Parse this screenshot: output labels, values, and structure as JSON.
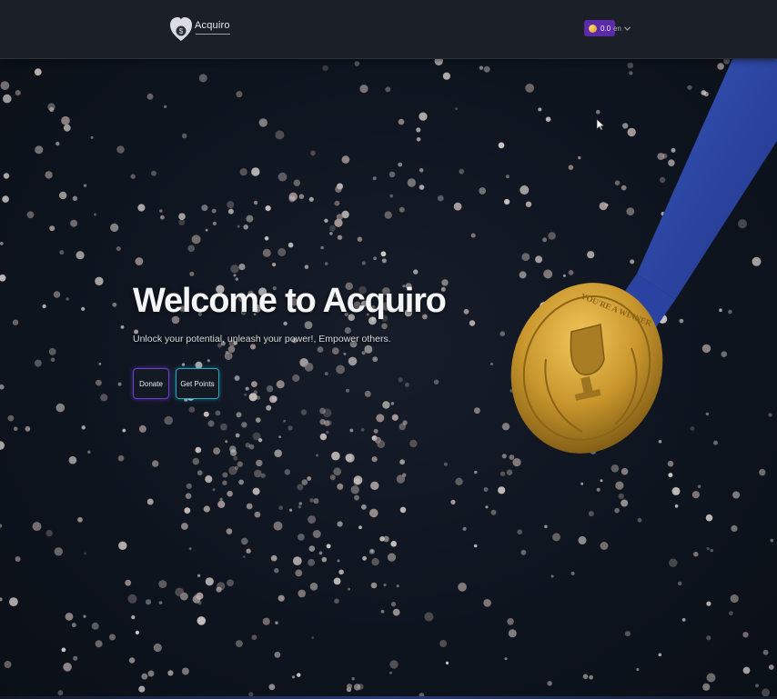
{
  "header": {
    "brand_name": "Acquiro",
    "logo_icon": "heart-coin-logo",
    "points_value": "0.0",
    "points_icon": "coin-icon",
    "language": "en",
    "language_icon": "chevron-down-icon",
    "accent_color": "#5b2aa8"
  },
  "hero": {
    "title": "Welcome to Acquiro",
    "subtitle": "Unlock your potential, unleash your power!, Empower others.",
    "buttons": {
      "donate_label": "Donate",
      "get_points_label": "Get Points"
    },
    "medal_text": "YOU'RE A WINNER",
    "background_art": "confetti-and-gold-medal",
    "colors": {
      "donate_border": "#6d3fd6",
      "get_points_border": "#2aa6c9",
      "ribbon": "#2e4aa8",
      "medal": "#c99a2e"
    }
  }
}
